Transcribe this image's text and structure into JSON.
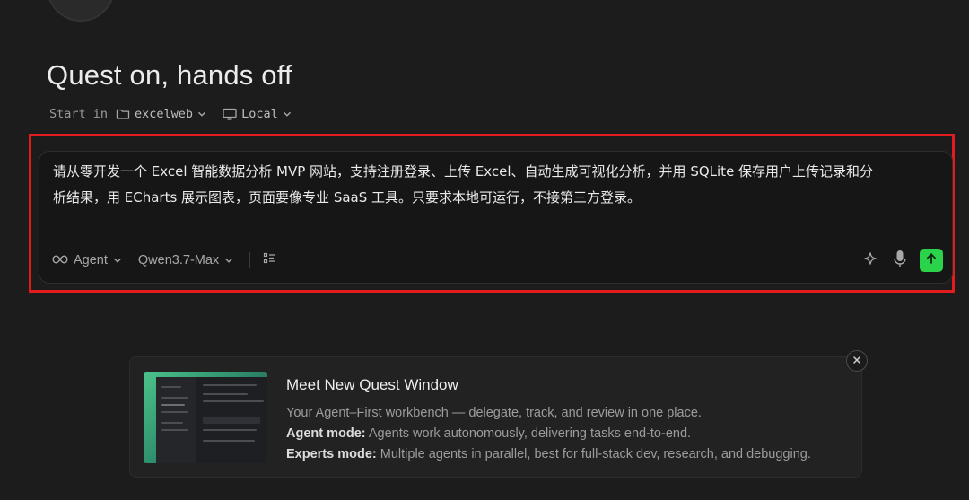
{
  "page": {
    "title": "Quest on, hands off",
    "start_in_label": "Start in",
    "folder": "excelweb",
    "environment": "Local"
  },
  "composer": {
    "prompt_lines": [
      "请从零开发一个 Excel 智能数据分析 MVP 网站，支持注册登录、上传 Excel、自动生成可视化分析，并用 SQLite 保存用户上传记录和分",
      "析结果，用 ECharts 展示图表，页面要像专业 SaaS 工具。只要求本地可运行，不接第三方登录。"
    ],
    "mode": "Agent",
    "model": "Qwen3.7-Max",
    "icons": {
      "mode": "infinity-icon",
      "tasks": "checklist-icon",
      "enhance": "sparkle-icon",
      "voice": "microphone-icon",
      "send": "arrow-up-icon"
    },
    "send_color": "#2bd34a",
    "highlight_color": "#e21c1c"
  },
  "promo": {
    "title": "Meet New Quest Window",
    "description": "Your Agent–First workbench — delegate, track, and review in one place.",
    "agent_label": "Agent mode:",
    "agent_text": " Agents work autonomously, delivering tasks end-to-end.",
    "experts_label": "Experts mode:",
    "experts_text": " Multiple agents in parallel, best for full-stack dev, research, and debugging.",
    "close_icon": "close-icon"
  }
}
